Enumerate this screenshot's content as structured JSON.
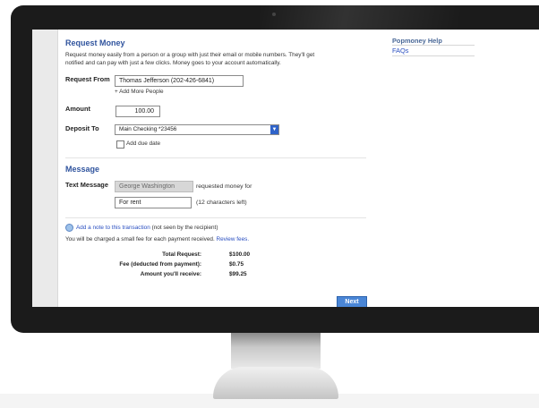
{
  "request_money": {
    "title": "Request Money",
    "description": "Request money easily from a person or a group with just their email or mobile numbers. They'll get notified and can pay with just a few clicks. Money goes to your account automatically.",
    "request_from_label": "Request From",
    "request_from_value": "Thomas Jefferson (202-426-6841)",
    "add_more_people": "+ Add More People",
    "amount_label": "Amount",
    "amount_value": "100.00",
    "deposit_to_label": "Deposit To",
    "deposit_to_value": "Main Checking *23456",
    "add_due_date": "Add due date"
  },
  "message": {
    "title": "Message",
    "text_message_label": "Text Message",
    "sender_name": "George Washington",
    "requested_text": "requested money for",
    "memo_value": "For rent",
    "chars_left": "(12 characters left)"
  },
  "note": {
    "link": "Add a note to this transaction",
    "suffix": "(not seen by the recipient)"
  },
  "fee_notice": {
    "text": "You will be charged a small fee for each payment received.",
    "link": "Review fees."
  },
  "totals": [
    {
      "label": "Total Request:",
      "value": "$100.00"
    },
    {
      "label": "Fee (deducted from payment):",
      "value": "$0.75"
    },
    {
      "label": "Amount you'll receive:",
      "value": "$99.25"
    }
  ],
  "next_button": "Next",
  "help": {
    "title": "Popmoney Help",
    "faqs": "FAQs"
  }
}
